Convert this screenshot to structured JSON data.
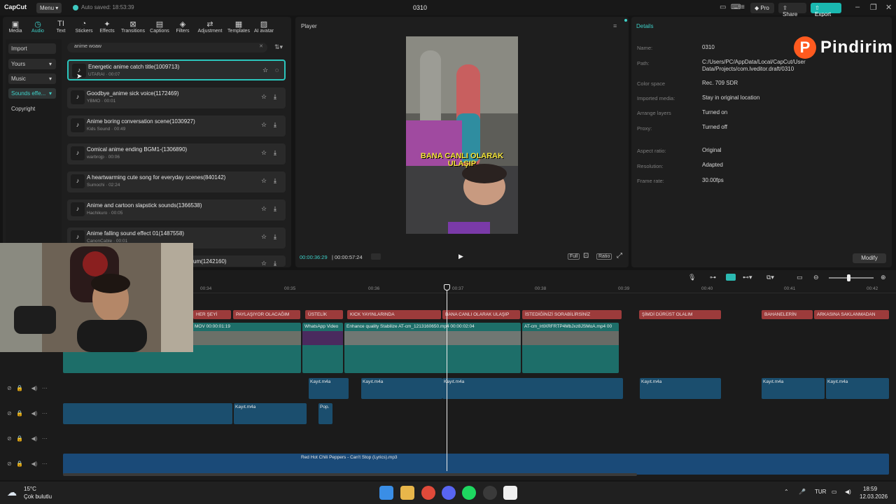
{
  "titlebar": {
    "logo": "CapCut",
    "menu": "Menu",
    "autosave": "Auto saved: 18:53:39",
    "project": "0310",
    "pro": "Pro",
    "share": "Share",
    "export": "Export"
  },
  "toptabs": [
    {
      "label": "Media",
      "icon": "media-icon"
    },
    {
      "label": "Audio",
      "icon": "audio-icon"
    },
    {
      "label": "Text",
      "icon": "text-icon"
    },
    {
      "label": "Stickers",
      "icon": "stickers-icon"
    },
    {
      "label": "Effects",
      "icon": "effects-icon"
    },
    {
      "label": "Transitions",
      "icon": "transitions-icon"
    },
    {
      "label": "Captions",
      "icon": "captions-icon"
    },
    {
      "label": "Filters",
      "icon": "filters-icon"
    },
    {
      "label": "Adjustment",
      "icon": "adjustment-icon"
    },
    {
      "label": "Templates",
      "icon": "templates-icon"
    },
    {
      "label": "AI avatar",
      "icon": "ai-avatar-icon"
    }
  ],
  "subnav": [
    "Import",
    "Yours",
    "Music",
    "Sounds effe...",
    "Copyright"
  ],
  "search": {
    "value": "anime woaw"
  },
  "sounds": [
    {
      "title": "Energetic anime catch title(1009713)",
      "meta": "UTARAI · 00:07"
    },
    {
      "title": "Goodbye_anime sick voice(1172469)",
      "meta": "YBMO · 00:01"
    },
    {
      "title": "Anime boring conversation scene(1030927)",
      "meta": "Kids Sound · 00:49"
    },
    {
      "title": "Comical anime ending BGM1-(1306890)",
      "meta": "warbrojp · 00:06"
    },
    {
      "title": "A heartwarming cute song for everyday scenes(840142)",
      "meta": "Sumochi · 02:24"
    },
    {
      "title": "Anime and cartoon slapstick sounds(1366538)",
      "meta": "Hachikuro · 00:05"
    },
    {
      "title": "Anime falling sound effect 01(1487558)",
      "meta": "CanonCable · 00:01"
    },
    {
      "title": "um(1242160)",
      "meta": ""
    }
  ],
  "player": {
    "title": "Player",
    "caption": "BANA CANLI OLARAK ULAŞIP",
    "current": "00:00:36:29",
    "total": "00:00:57:24",
    "full": "Full",
    "ratio": "Ratio"
  },
  "details": {
    "title": "Details",
    "rows": [
      {
        "label": "Name:",
        "value": "0310"
      },
      {
        "label": "Path:",
        "value": "C:/Users/PC/AppData/Local/CapCut/User Data/Projects/com.lveditor.draft/0310"
      },
      {
        "label": "Color space",
        "value": "Rec. 709 SDR"
      },
      {
        "label": "Imported media:",
        "value": "Stay in original location"
      },
      {
        "label": "Arrange layers",
        "value": "Turned on"
      },
      {
        "label": "Proxy:",
        "value": "Turned off"
      },
      {
        "label": "Aspect ratio:",
        "value": "Original"
      },
      {
        "label": "Resolution:",
        "value": "Adapted"
      },
      {
        "label": "Frame rate:",
        "value": "30.00fps"
      }
    ],
    "modify": "Modify"
  },
  "watermark": {
    "letter": "P",
    "text": "Pindirim"
  },
  "ruler": [
    "00:34",
    "00:35",
    "00:36",
    "00:37",
    "00:38",
    "00:39",
    "00:40",
    "00:41",
    "00:42"
  ],
  "text_clips": [
    "HER ŞEYİ",
    "PAYLAŞIYOR OLACAĞIM",
    "ÜSTELİK",
    "KICK YAYINLARINDA",
    "BANA CANLI OLARAK ULAŞIP",
    "İSTEDİĞİNİZİ SORABİLİRSİNİZ",
    "ŞİMDİ DÜRÜST OLALIM",
    "BAHANELERİN",
    "ARKASINA SAKLANMADAN"
  ],
  "video_clips": [
    {
      "label": "MOV  00:00:01:19"
    },
    {
      "label": "WhatsApp Video"
    },
    {
      "label": "Enhance quality  Stabilize  AT-cm_1213160650.mp4  00:00:02:04"
    },
    {
      "label": "AT-cm_lrtlXRFRTP4MbJxz8JSMoA.mp4  00"
    }
  ],
  "audio_labels": [
    "Kayıt.m4a",
    "Kayıt.m4a",
    "Kayıt.m4a",
    "Kayıt.m4a",
    "Kayıt.m4a",
    "Kayıt.m4a",
    "Kayıt.m4a",
    "Pop."
  ],
  "music_clip": "Red Hot Chili Peppers - Can't Stop (Lyrics).mp3",
  "taskbar": {
    "temp": "15°C",
    "weather": "Çok bulutlu",
    "lang": "TUR",
    "time": "18:59",
    "date": "12.03.2026"
  },
  "colors": {
    "accent": "#3ed0c8",
    "text_clip": "#9c3b3b",
    "video_clip": "#1d6e69",
    "audio_clip": "#1b4e6e",
    "export": "#1ab8b0"
  }
}
